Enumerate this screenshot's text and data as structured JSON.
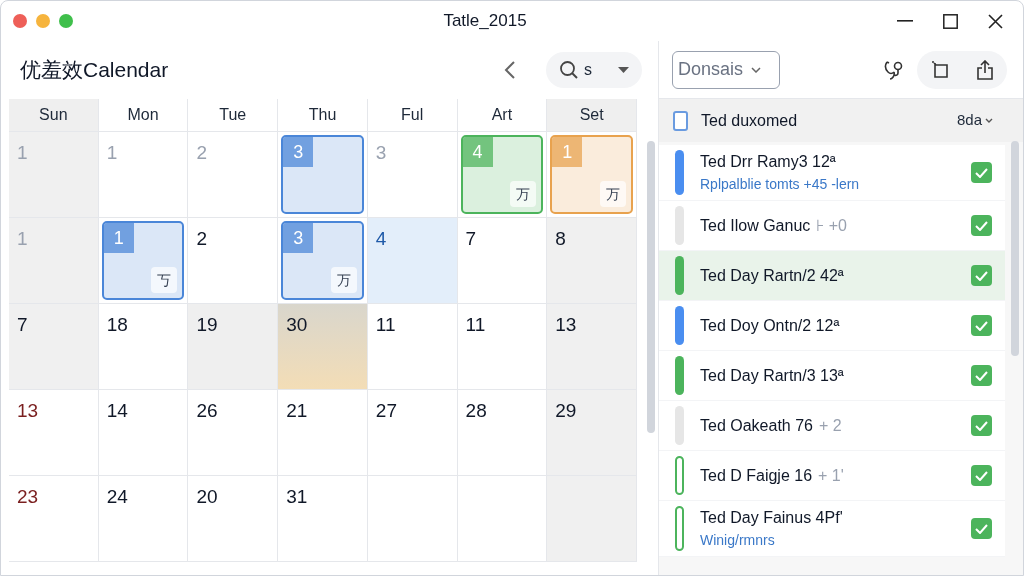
{
  "window": {
    "title": "Tatle_2015"
  },
  "calendar": {
    "title": "优羞效Calendar",
    "search": {
      "value": "s"
    },
    "weekdays": [
      {
        "label": "Sun",
        "weekend": true
      },
      {
        "label": "Mon",
        "weekend": false
      },
      {
        "label": "Tue",
        "weekend": false
      },
      {
        "label": "Thu",
        "weekend": false
      },
      {
        "label": "Ful",
        "weekend": false
      },
      {
        "label": "Art",
        "weekend": false
      },
      {
        "label": "Set",
        "weekend": true
      }
    ],
    "weeks": [
      [
        {
          "day": "1",
          "kind": "weekend",
          "muted": true,
          "holiday": false
        },
        {
          "day": "1",
          "kind": "plain",
          "muted": true,
          "holiday": false
        },
        {
          "day": "2",
          "kind": "plain",
          "muted": true,
          "holiday": false
        },
        {
          "day": "3",
          "kind": "event",
          "event": {
            "color": "#4a86d8"
          }
        },
        {
          "day": "3",
          "kind": "plain",
          "muted": true,
          "holiday": false
        },
        {
          "day": "4",
          "kind": "event",
          "event": {
            "color": "#4cb45c",
            "badge": "万"
          }
        },
        {
          "day": "1",
          "kind": "event",
          "event": {
            "color": "#e8a24e",
            "badge": "万"
          }
        }
      ],
      [
        {
          "day": "1",
          "kind": "weekend",
          "muted": true,
          "holiday": false
        },
        {
          "day": "1",
          "kind": "event",
          "event": {
            "color": "#4a86d8",
            "badge": "丂"
          }
        },
        {
          "day": "2",
          "kind": "plain",
          "muted": false,
          "holiday": false
        },
        {
          "day": "3",
          "kind": "event",
          "event": {
            "color": "#4a86d8",
            "badge": "万"
          }
        },
        {
          "day": "4",
          "kind": "today",
          "muted": false,
          "holiday": false
        },
        {
          "day": "7",
          "kind": "plain",
          "muted": false,
          "holiday": false
        },
        {
          "day": "8",
          "kind": "weekend",
          "muted": false,
          "holiday": false
        }
      ],
      [
        {
          "day": "7",
          "kind": "weekend",
          "muted": false,
          "holiday": false
        },
        {
          "day": "18",
          "kind": "plain",
          "muted": false,
          "holiday": false
        },
        {
          "day": "19",
          "kind": "shaded",
          "muted": false,
          "holiday": false
        },
        {
          "day": "30",
          "kind": "sunset",
          "muted": false,
          "holiday": false
        },
        {
          "day": "11",
          "kind": "plain",
          "muted": false,
          "holiday": false
        },
        {
          "day": "11",
          "kind": "plain",
          "muted": false,
          "holiday": false
        },
        {
          "day": "13",
          "kind": "weekend",
          "muted": false,
          "holiday": false
        }
      ],
      [
        {
          "day": "13",
          "kind": "plain",
          "muted": false,
          "holiday": true
        },
        {
          "day": "14",
          "kind": "plain",
          "muted": false,
          "holiday": false
        },
        {
          "day": "26",
          "kind": "plain",
          "muted": false,
          "holiday": false
        },
        {
          "day": "21",
          "kind": "plain",
          "muted": false,
          "holiday": false
        },
        {
          "day": "27",
          "kind": "plain",
          "muted": false,
          "holiday": false
        },
        {
          "day": "28",
          "kind": "plain",
          "muted": false,
          "holiday": false
        },
        {
          "day": "29",
          "kind": "weekend",
          "muted": false,
          "holiday": false
        }
      ],
      [
        {
          "day": "23",
          "kind": "plain",
          "muted": false,
          "holiday": true
        },
        {
          "day": "24",
          "kind": "plain",
          "muted": false,
          "holiday": false
        },
        {
          "day": "20",
          "kind": "plain",
          "muted": false,
          "holiday": false
        },
        {
          "day": "31",
          "kind": "plain",
          "muted": false,
          "holiday": false
        }
      ]
    ]
  },
  "tasks": {
    "filter": "Donsais",
    "header": {
      "label": "Ted duxomed",
      "checked": false,
      "sort": "8da"
    },
    "items": [
      {
        "title": "Ted Drr Ramy3 12ª",
        "subtitle": "Rplpalblie tomts +45 -lern",
        "color": "#4a8ef0",
        "kind": "solid",
        "checked": true,
        "selected": false
      },
      {
        "title": "Ted Ilow Ganuc",
        "extra": "⊦ +0",
        "color": "#e6e6e6",
        "kind": "solid",
        "checked": true,
        "selected": false
      },
      {
        "title": "Ted Day Rartn/2 42ª",
        "color": "#4cb45c",
        "kind": "solid",
        "checked": true,
        "selected": true
      },
      {
        "title": "Ted Doy Ontn/2 12ª",
        "color": "#4a8ef0",
        "kind": "solid",
        "checked": true,
        "selected": false
      },
      {
        "title": "Ted Day Rartn/3 13ª",
        "color": "#4cb45c",
        "kind": "solid",
        "checked": true,
        "selected": false
      },
      {
        "title": "Ted Oakeath 76",
        "extra": "+ 2",
        "color": "#e6e6e6",
        "kind": "solid",
        "checked": true,
        "selected": false
      },
      {
        "title": "Ted D Faigje 16",
        "extra": "+ 1'",
        "color": "#4cb45c",
        "kind": "outline",
        "checked": true,
        "selected": false
      },
      {
        "title": "Ted Day Fainus 4Pf'",
        "subtitle": "Winig/rmnrs",
        "color": "#4cb45c",
        "kind": "outline",
        "checked": true,
        "selected": false
      }
    ]
  }
}
